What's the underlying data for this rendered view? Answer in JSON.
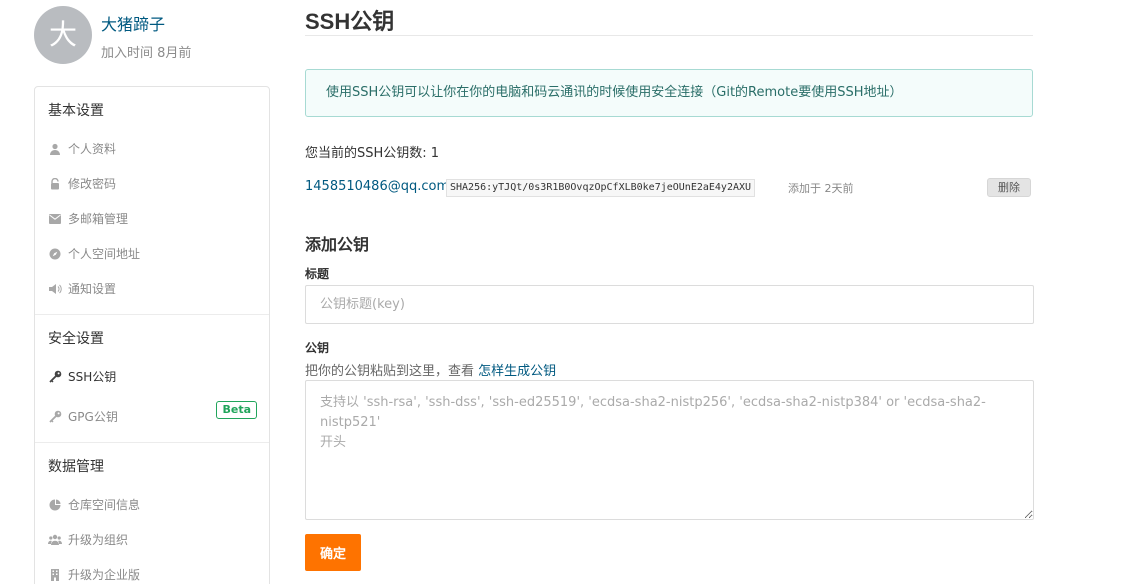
{
  "profile": {
    "avatar_letter": "大",
    "name": "大猪蹄子",
    "joined": "加入时间 8月前"
  },
  "sidebar": {
    "sections": [
      {
        "title": "基本设置",
        "items": [
          {
            "label": "个人资料",
            "icon": "user-icon"
          },
          {
            "label": "修改密码",
            "icon": "lock-icon"
          },
          {
            "label": "多邮箱管理",
            "icon": "envelope-icon"
          },
          {
            "label": "个人空间地址",
            "icon": "compass-icon"
          },
          {
            "label": "通知设置",
            "icon": "volume-icon"
          }
        ]
      },
      {
        "title": "安全设置",
        "items": [
          {
            "label": "SSH公钥",
            "icon": "key-icon",
            "active": true
          },
          {
            "label": "GPG公钥",
            "icon": "key-icon",
            "badge": "Beta"
          }
        ]
      },
      {
        "title": "数据管理",
        "items": [
          {
            "label": "仓库空间信息",
            "icon": "pie-chart-icon"
          },
          {
            "label": "升级为组织",
            "icon": "users-icon"
          },
          {
            "label": "升级为企业版",
            "icon": "building-icon"
          }
        ]
      }
    ]
  },
  "main": {
    "title": "SSH公钥",
    "info": "使用SSH公钥可以让你在你的电脑和码云通讯的时候使用安全连接（Git的Remote要使用SSH地址）",
    "count_text": "您当前的SSH公钥数: 1",
    "key": {
      "email": "1458510486@qq.com",
      "fingerprint": "SHA256:yTJQt/0s3R1B0OvqzOpCfXLB0ke7jeOUnE2aE4y2AXU",
      "added": "添加于 2天前",
      "delete_label": "删除"
    },
    "add": {
      "heading": "添加公钥",
      "title_label": "标题",
      "title_placeholder": "公钥标题(key)",
      "key_label": "公钥",
      "key_hint": "把你的公钥粘贴到这里，查看",
      "key_hint_link": "怎样生成公钥",
      "key_placeholder": "支持以 'ssh-rsa', 'ssh-dss', 'ssh-ed25519', 'ecdsa-sha2-nistp256', 'ecdsa-sha2-nistp384' or 'ecdsa-sha2-nistp521'\n开头",
      "confirm_label": "确定"
    }
  },
  "colors": {
    "accent": "#fe7300",
    "link": "#005980",
    "info_border": "#a7dad3",
    "info_bg": "#f4fcfb",
    "beta": "#21a55b"
  }
}
